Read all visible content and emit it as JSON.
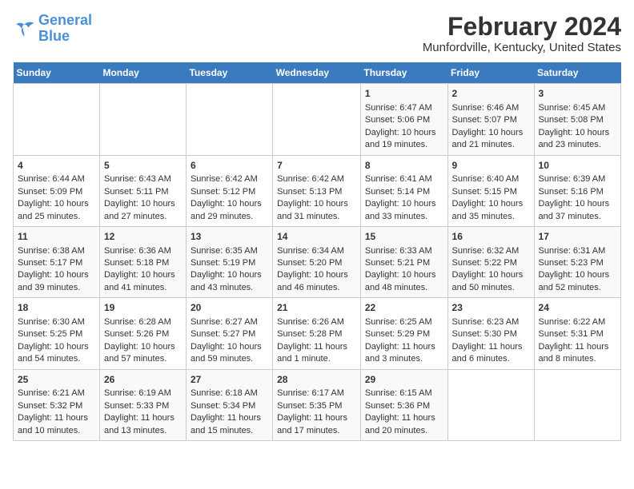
{
  "logo": {
    "line1": "General",
    "line2": "Blue"
  },
  "title": "February 2024",
  "subtitle": "Munfordville, Kentucky, United States",
  "days_of_week": [
    "Sunday",
    "Monday",
    "Tuesday",
    "Wednesday",
    "Thursday",
    "Friday",
    "Saturday"
  ],
  "weeks": [
    [
      {
        "day": "",
        "content": ""
      },
      {
        "day": "",
        "content": ""
      },
      {
        "day": "",
        "content": ""
      },
      {
        "day": "",
        "content": ""
      },
      {
        "day": "1",
        "content": "Sunrise: 6:47 AM\nSunset: 5:06 PM\nDaylight: 10 hours and 19 minutes."
      },
      {
        "day": "2",
        "content": "Sunrise: 6:46 AM\nSunset: 5:07 PM\nDaylight: 10 hours and 21 minutes."
      },
      {
        "day": "3",
        "content": "Sunrise: 6:45 AM\nSunset: 5:08 PM\nDaylight: 10 hours and 23 minutes."
      }
    ],
    [
      {
        "day": "4",
        "content": "Sunrise: 6:44 AM\nSunset: 5:09 PM\nDaylight: 10 hours and 25 minutes."
      },
      {
        "day": "5",
        "content": "Sunrise: 6:43 AM\nSunset: 5:11 PM\nDaylight: 10 hours and 27 minutes."
      },
      {
        "day": "6",
        "content": "Sunrise: 6:42 AM\nSunset: 5:12 PM\nDaylight: 10 hours and 29 minutes."
      },
      {
        "day": "7",
        "content": "Sunrise: 6:42 AM\nSunset: 5:13 PM\nDaylight: 10 hours and 31 minutes."
      },
      {
        "day": "8",
        "content": "Sunrise: 6:41 AM\nSunset: 5:14 PM\nDaylight: 10 hours and 33 minutes."
      },
      {
        "day": "9",
        "content": "Sunrise: 6:40 AM\nSunset: 5:15 PM\nDaylight: 10 hours and 35 minutes."
      },
      {
        "day": "10",
        "content": "Sunrise: 6:39 AM\nSunset: 5:16 PM\nDaylight: 10 hours and 37 minutes."
      }
    ],
    [
      {
        "day": "11",
        "content": "Sunrise: 6:38 AM\nSunset: 5:17 PM\nDaylight: 10 hours and 39 minutes."
      },
      {
        "day": "12",
        "content": "Sunrise: 6:36 AM\nSunset: 5:18 PM\nDaylight: 10 hours and 41 minutes."
      },
      {
        "day": "13",
        "content": "Sunrise: 6:35 AM\nSunset: 5:19 PM\nDaylight: 10 hours and 43 minutes."
      },
      {
        "day": "14",
        "content": "Sunrise: 6:34 AM\nSunset: 5:20 PM\nDaylight: 10 hours and 46 minutes."
      },
      {
        "day": "15",
        "content": "Sunrise: 6:33 AM\nSunset: 5:21 PM\nDaylight: 10 hours and 48 minutes."
      },
      {
        "day": "16",
        "content": "Sunrise: 6:32 AM\nSunset: 5:22 PM\nDaylight: 10 hours and 50 minutes."
      },
      {
        "day": "17",
        "content": "Sunrise: 6:31 AM\nSunset: 5:23 PM\nDaylight: 10 hours and 52 minutes."
      }
    ],
    [
      {
        "day": "18",
        "content": "Sunrise: 6:30 AM\nSunset: 5:25 PM\nDaylight: 10 hours and 54 minutes."
      },
      {
        "day": "19",
        "content": "Sunrise: 6:28 AM\nSunset: 5:26 PM\nDaylight: 10 hours and 57 minutes."
      },
      {
        "day": "20",
        "content": "Sunrise: 6:27 AM\nSunset: 5:27 PM\nDaylight: 10 hours and 59 minutes."
      },
      {
        "day": "21",
        "content": "Sunrise: 6:26 AM\nSunset: 5:28 PM\nDaylight: 11 hours and 1 minute."
      },
      {
        "day": "22",
        "content": "Sunrise: 6:25 AM\nSunset: 5:29 PM\nDaylight: 11 hours and 3 minutes."
      },
      {
        "day": "23",
        "content": "Sunrise: 6:23 AM\nSunset: 5:30 PM\nDaylight: 11 hours and 6 minutes."
      },
      {
        "day": "24",
        "content": "Sunrise: 6:22 AM\nSunset: 5:31 PM\nDaylight: 11 hours and 8 minutes."
      }
    ],
    [
      {
        "day": "25",
        "content": "Sunrise: 6:21 AM\nSunset: 5:32 PM\nDaylight: 11 hours and 10 minutes."
      },
      {
        "day": "26",
        "content": "Sunrise: 6:19 AM\nSunset: 5:33 PM\nDaylight: 11 hours and 13 minutes."
      },
      {
        "day": "27",
        "content": "Sunrise: 6:18 AM\nSunset: 5:34 PM\nDaylight: 11 hours and 15 minutes."
      },
      {
        "day": "28",
        "content": "Sunrise: 6:17 AM\nSunset: 5:35 PM\nDaylight: 11 hours and 17 minutes."
      },
      {
        "day": "29",
        "content": "Sunrise: 6:15 AM\nSunset: 5:36 PM\nDaylight: 11 hours and 20 minutes."
      },
      {
        "day": "",
        "content": ""
      },
      {
        "day": "",
        "content": ""
      }
    ]
  ]
}
